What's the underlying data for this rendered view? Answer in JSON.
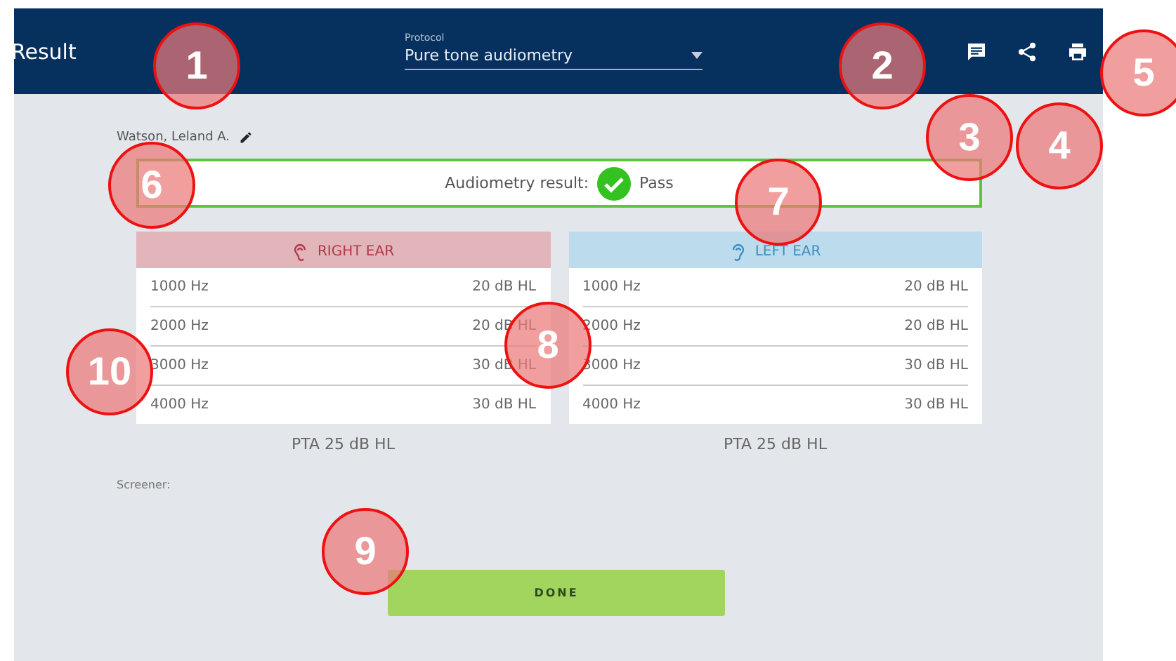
{
  "header": {
    "title": "Result",
    "protocol_label": "Protocol",
    "protocol_value": "Pure tone audiometry"
  },
  "patient": "Watson, Leland A.",
  "result": {
    "label": "Audiometry result:",
    "value": "Pass",
    "passed": true
  },
  "ears": [
    {
      "kind": "right",
      "title": "RIGHT EAR",
      "rows": [
        {
          "frequency": "1000 Hz",
          "threshold": "20 dB HL"
        },
        {
          "frequency": "2000 Hz",
          "threshold": "20 dB HL"
        },
        {
          "frequency": "3000 Hz",
          "threshold": "30 dB HL"
        },
        {
          "frequency": "4000 Hz",
          "threshold": "30 dB HL"
        }
      ],
      "pta": "PTA 25 dB HL"
    },
    {
      "kind": "left",
      "title": "LEFT EAR",
      "rows": [
        {
          "frequency": "1000 Hz",
          "threshold": "20 dB HL"
        },
        {
          "frequency": "2000 Hz",
          "threshold": "20 dB HL"
        },
        {
          "frequency": "3000 Hz",
          "threshold": "30 dB HL"
        },
        {
          "frequency": "4000 Hz",
          "threshold": "30 dB HL"
        }
      ],
      "pta": "PTA 25 dB HL"
    }
  ],
  "screener_label": "Screener:",
  "done_button": "DONE",
  "callouts": [
    "1",
    "2",
    "3",
    "4",
    "5",
    "6",
    "7",
    "8",
    "9",
    "10"
  ]
}
